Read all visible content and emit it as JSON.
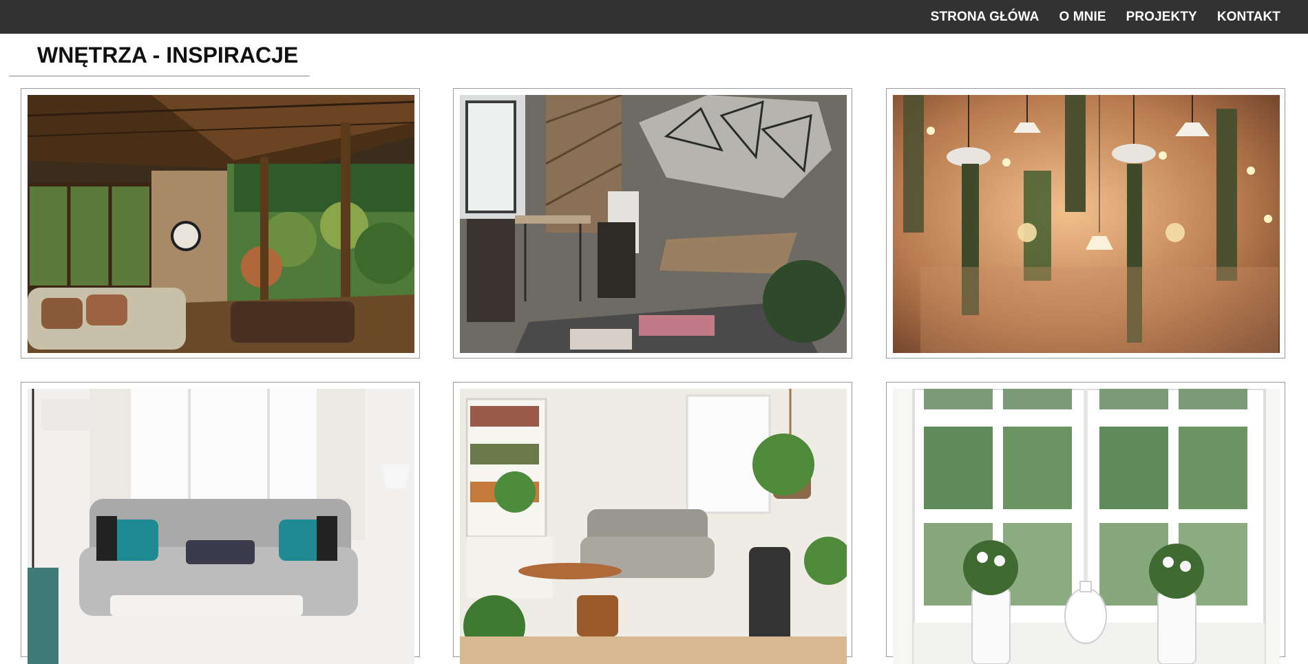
{
  "nav": {
    "items": [
      {
        "label": "STRONA GŁÓWA"
      },
      {
        "label": "O MNIE"
      },
      {
        "label": "PROJEKTY"
      },
      {
        "label": "KONTAKT"
      }
    ]
  },
  "page": {
    "title": "WNĘTRZA - INSPIRACJE"
  },
  "gallery": {
    "photos": [
      {
        "subject": "covered porch living room with garden view"
      },
      {
        "subject": "cafe interior with geometric mirror"
      },
      {
        "subject": "hanging plants and pendant light bulbs"
      },
      {
        "subject": "bright living room with grey tufted sofa"
      },
      {
        "subject": "cozy living room with bookshelves and plants"
      },
      {
        "subject": "white window with potted flowers and teapot"
      }
    ]
  },
  "colors": {
    "topbar": "#323232",
    "nav_text": "#ffffff",
    "title_text": "#111111",
    "card_border": "#9a9a9a"
  }
}
